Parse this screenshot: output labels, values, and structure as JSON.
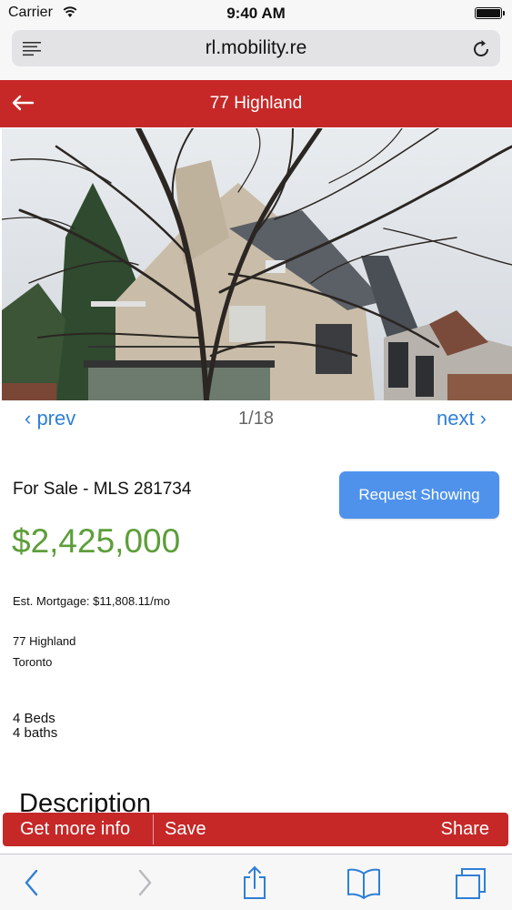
{
  "status_bar": {
    "carrier": "Carrier",
    "time": "9:40 AM"
  },
  "browser": {
    "url": "rl.mobility.re"
  },
  "header": {
    "title": "77 Highland"
  },
  "gallery": {
    "prev_label": "‹ prev",
    "counter": "1/18",
    "next_label": "next ›"
  },
  "listing": {
    "status_line": "For Sale - MLS 281734",
    "request_button": "Request Showing",
    "price": "$2,425,000",
    "mortgage": "Est. Mortgage: $11,808.11/mo",
    "address_line1": "77 Highland",
    "address_line2": "Toronto",
    "beds": "4 Beds",
    "baths": "4 baths",
    "description_heading": "Description"
  },
  "action_bar": {
    "more_info": "Get more info",
    "save": "Save",
    "share": "Share"
  },
  "colors": {
    "header_red": "#c62828",
    "price_green": "#5d9e3a",
    "button_blue": "#4f92ec",
    "link_blue": "#2f7fd6"
  },
  "icons": [
    "wifi-icon",
    "battery-icon",
    "reader-menu-icon",
    "reload-icon",
    "back-arrow-icon",
    "browser-back-icon",
    "browser-forward-icon",
    "share-icon",
    "bookmarks-icon",
    "tabs-icon"
  ]
}
